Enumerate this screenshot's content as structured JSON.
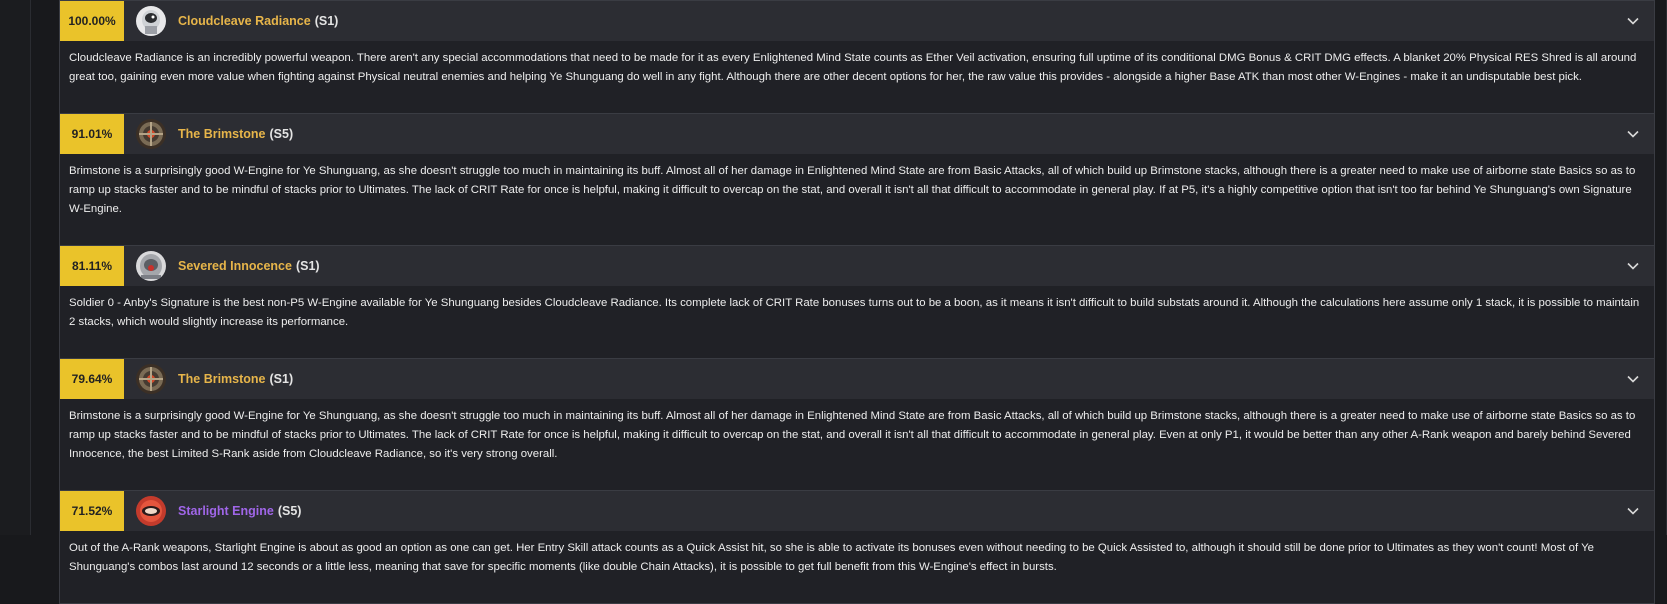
{
  "engines": [
    {
      "percent": "100.00%",
      "name": "Cloudcleave Radiance",
      "rank": "(S1)",
      "icon": "astronaut-helmet-icon",
      "name_color": "#e7b54a",
      "description": "Cloudcleave Radiance is an incredibly powerful weapon. There aren't any special accommodations that need to be made for it as every Enlightened Mind State counts as Ether Veil activation, ensuring full uptime of its conditional DMG Bonus & CRIT DMG effects. A blanket 20% Physical RES Shred is all around great too, gaining even more value when fighting against Physical neutral enemies and helping Ye Shunguang do well in any fight. Although there are other decent options for her, the raw value this provides - alongside a higher Base ATK than most other W-Engines - make it an undisputable best pick."
    },
    {
      "percent": "91.01%",
      "name": "The Brimstone",
      "rank": "(S5)",
      "icon": "brimstone-orb-icon",
      "name_color": "#e7b54a",
      "description": "Brimstone is a surprisingly good W-Engine for Ye Shunguang, as she doesn't struggle too much in maintaining its buff. Almost all of her damage in Enlightened Mind State are from Basic Attacks, all of which build up Brimstone stacks, although there is a greater need to make use of airborne state Basics so as to ramp up stacks faster and to be mindful of stacks prior to Ultimates. The lack of CRIT Rate for once is helpful, making it difficult to overcap on the stat, and overall it isn't all that difficult to accommodate in general play. If at P5, it's a highly competitive option that isn't too far behind Ye Shunguang's own Signature W-Engine."
    },
    {
      "percent": "81.11%",
      "name": "Severed Innocence",
      "rank": "(S1)",
      "icon": "robot-helmet-icon",
      "name_color": "#e7b54a",
      "description": "Soldier 0 - Anby's Signature is the best non-P5 W-Engine available for Ye Shunguang besides Cloudcleave Radiance. Its complete lack of CRIT Rate bonuses turns out to be a boon, as it means it isn't difficult to build substats around it. Although the calculations here assume only 1 stack, it is possible to maintain 2 stacks, which would slightly increase its performance."
    },
    {
      "percent": "79.64%",
      "name": "The Brimstone",
      "rank": "(S1)",
      "icon": "brimstone-orb-icon",
      "name_color": "#e7b54a",
      "description": "Brimstone is a surprisingly good W-Engine for Ye Shunguang, as she doesn't struggle too much in maintaining its buff. Almost all of her damage in Enlightened Mind State are from Basic Attacks, all of which build up Brimstone stacks, although there is a greater need to make use of airborne state Basics so as to ramp up stacks faster and to be mindful of stacks prior to Ultimates. The lack of CRIT Rate for once is helpful, making it difficult to overcap on the stat, and overall it isn't all that difficult to accommodate in general play. Even at only P1, it would be better than any other A-Rank weapon and barely behind Severed Innocence, the best Limited S-Rank aside from Cloudcleave Radiance, so it's very strong overall."
    },
    {
      "percent": "71.52%",
      "name": "Starlight Engine",
      "rank": "(S5)",
      "icon": "starlight-engine-icon",
      "name_color": "#a066e8",
      "description": "Out of the A-Rank weapons, Starlight Engine is about as good an option as one can get. Her Entry Skill attack counts as a Quick Assist hit, so she is able to activate its bonuses even without needing to be Quick Assisted to, although it should still be done prior to Ultimates as they won't count! Most of Ye Shunguang's combos last around 12 seconds or a little less, meaning that save for specific moments (like double Chain Attacks), it is possible to get full benefit from this W-Engine's effect in bursts."
    }
  ]
}
